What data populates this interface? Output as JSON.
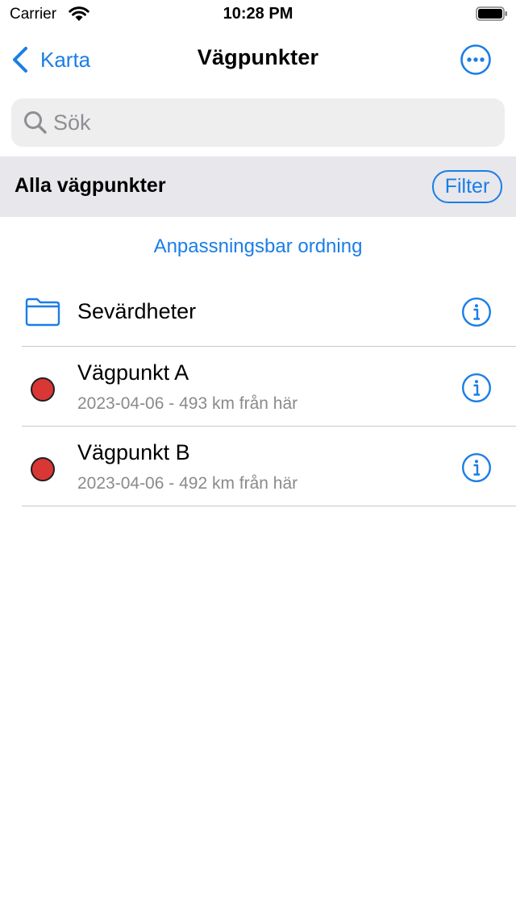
{
  "status_bar": {
    "carrier": "Carrier",
    "time": "10:28 PM"
  },
  "nav": {
    "back_label": "Karta",
    "title": "Vägpunkter",
    "more_icon": "ellipsis-circle-icon"
  },
  "search": {
    "placeholder": "Sök",
    "value": ""
  },
  "section": {
    "title": "Alla vägpunkter",
    "filter_label": "Filter"
  },
  "sort_link": "Anpassningsbar ordning",
  "items": [
    {
      "type": "folder",
      "icon": "folder-icon",
      "title": "Sevärdheter"
    },
    {
      "type": "waypoint",
      "icon": "red-dot-icon",
      "title": "Vägpunkt A",
      "subtitle": "2023-04-06 - 493 km från här"
    },
    {
      "type": "waypoint",
      "icon": "red-dot-icon",
      "title": "Vägpunkt B",
      "subtitle": "2023-04-06 - 492 km från här"
    }
  ],
  "colors": {
    "accent": "#1a7ee6",
    "waypoint": "#d93636",
    "section_bg": "#e7e7ec",
    "search_bg": "#eeeeef",
    "secondary_text": "#8a8a8e"
  }
}
